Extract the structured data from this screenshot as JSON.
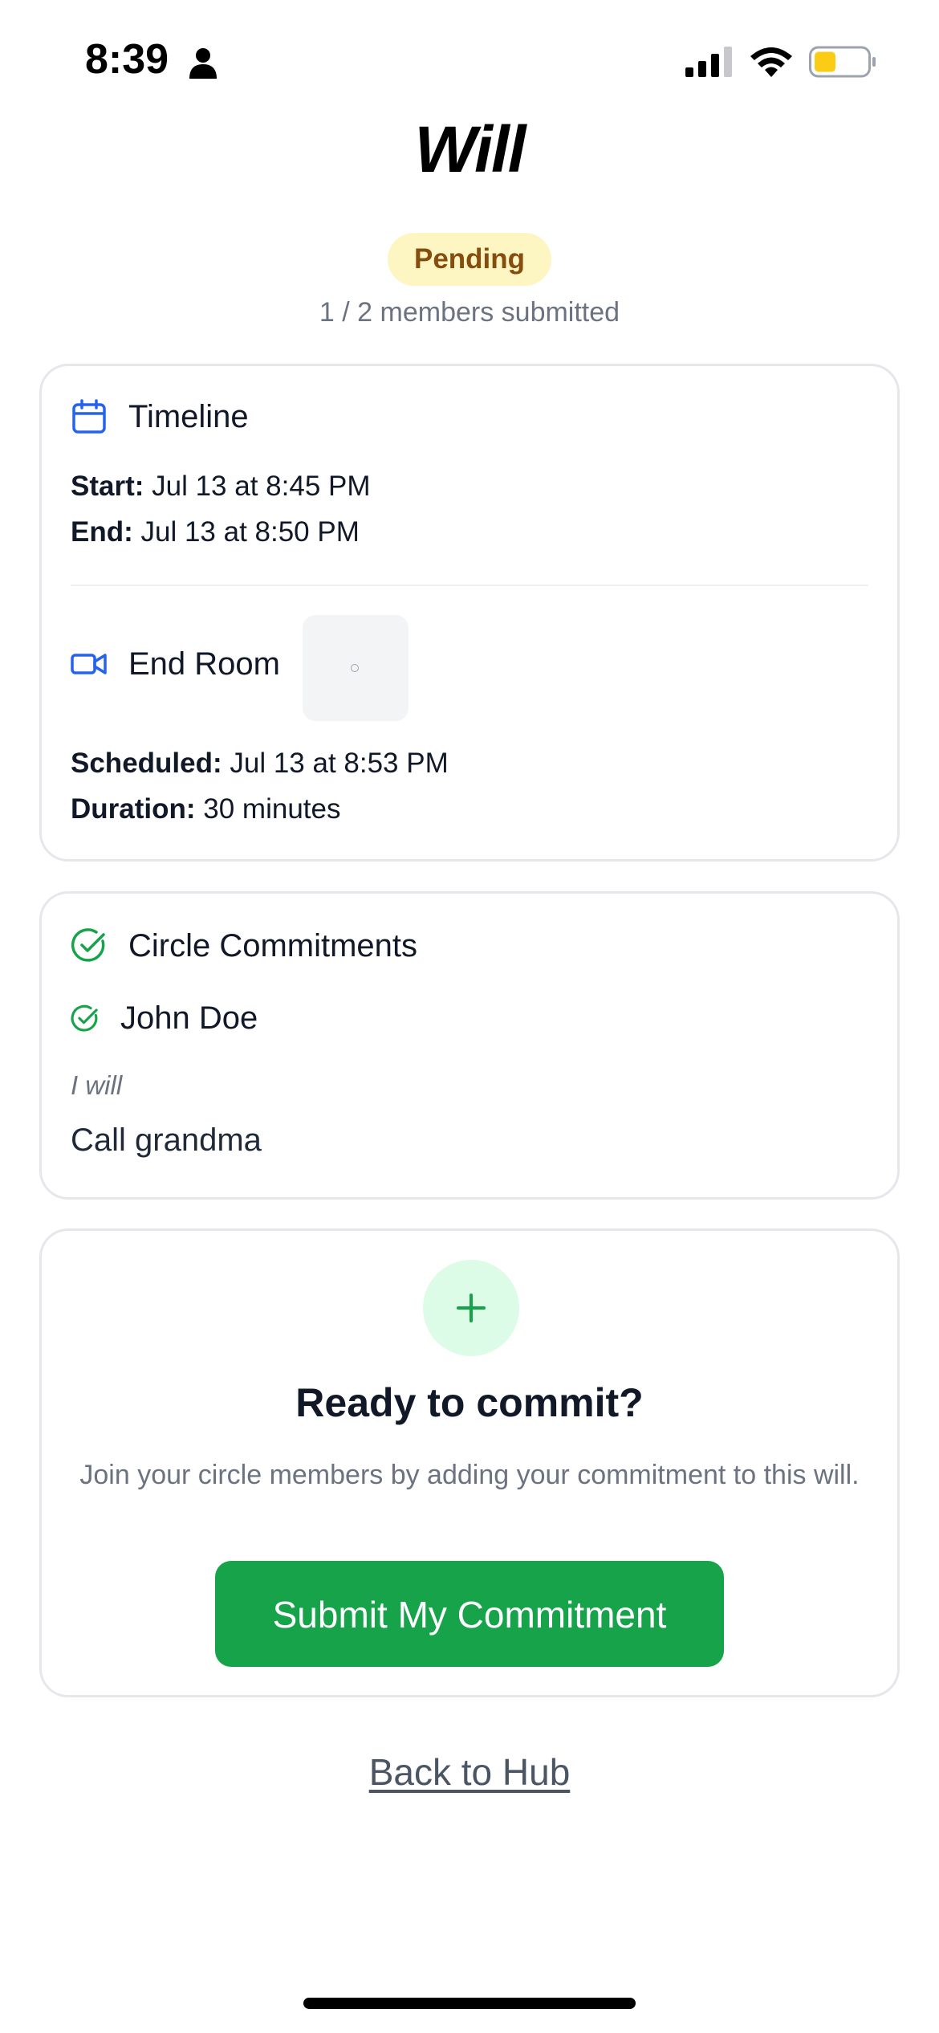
{
  "status_bar": {
    "time": "8:39"
  },
  "header": {
    "title": "Will"
  },
  "status": {
    "badge": "Pending",
    "members_submitted": "1 / 2 members submitted"
  },
  "timeline": {
    "title": "Timeline",
    "start_label": "Start:",
    "start_value": " Jul 13 at 8:45 PM",
    "end_label": "End:",
    "end_value": " Jul 13 at 8:50 PM"
  },
  "end_room": {
    "title": "End Room",
    "scheduled_label": "Scheduled:",
    "scheduled_value": " Jul 13 at 8:53 PM",
    "duration_label": "Duration:",
    "duration_value": " 30 minutes"
  },
  "commitments": {
    "title": "Circle Commitments",
    "members": [
      {
        "name": "John Doe",
        "prefix": "I will",
        "text": "Call grandma"
      }
    ]
  },
  "ready": {
    "heading": "Ready to commit?",
    "description": "Join your circle members by adding your commitment to this will.",
    "button_label": "Submit My Commitment"
  },
  "footer": {
    "back_link": "Back to Hub"
  },
  "colors": {
    "accent_green": "#16a34a",
    "accent_blue": "#2563eb",
    "badge_bg": "#fdf6c3",
    "badge_text": "#854d0e"
  },
  "icons": {
    "person": "person-icon",
    "signal": "signal-icon",
    "wifi": "wifi-icon",
    "battery": "battery-icon",
    "calendar": "calendar-icon",
    "video": "video-camera-icon",
    "check_circle": "check-circle-icon",
    "plus": "plus-icon"
  }
}
